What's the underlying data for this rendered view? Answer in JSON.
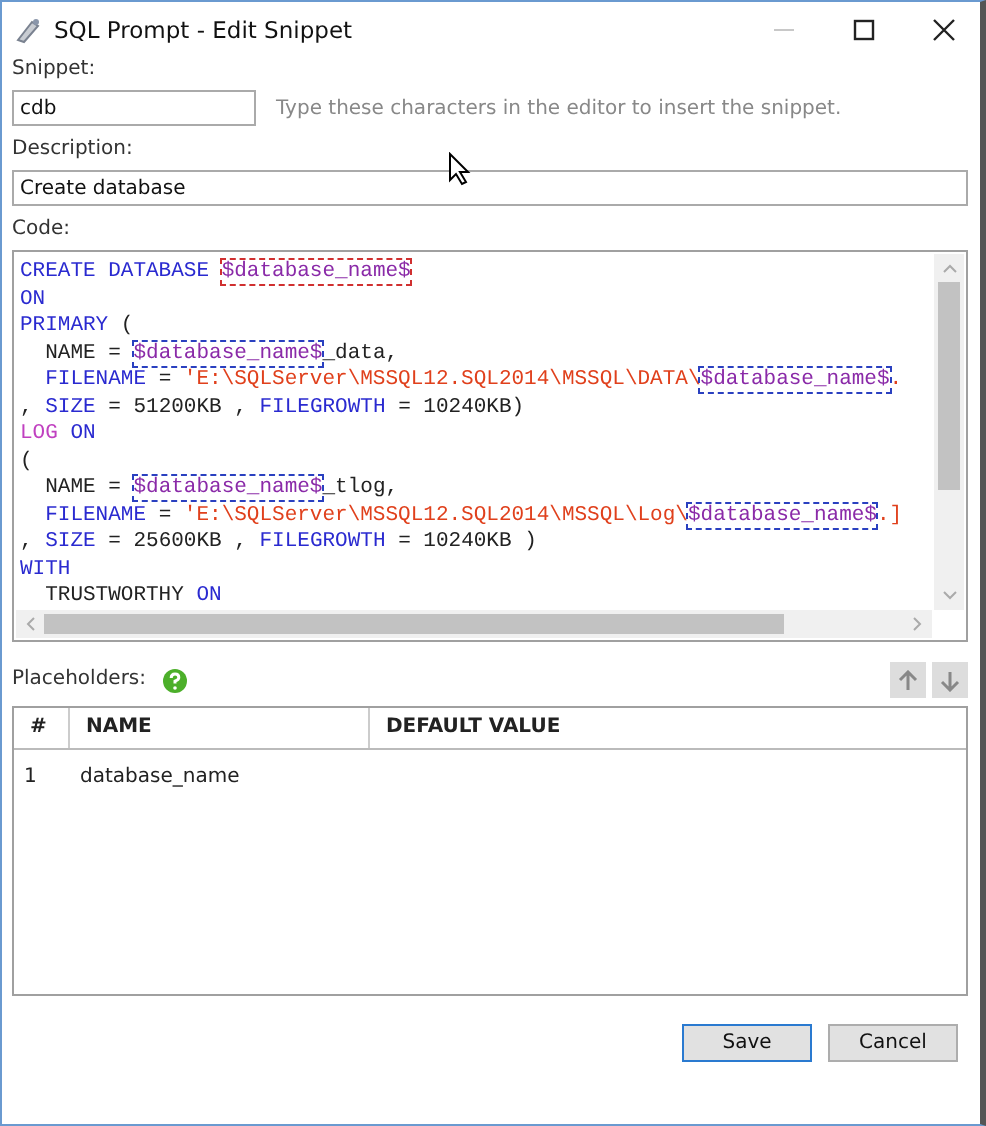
{
  "window": {
    "title": "SQL Prompt - Edit Snippet"
  },
  "snippet": {
    "label": "Snippet:",
    "value": "cdb",
    "hint": "Type these characters in the editor to insert the snippet."
  },
  "description": {
    "label": "Description:",
    "value": "Create database"
  },
  "code": {
    "label": "Code:",
    "lines": [
      [
        {
          "kind": "kw",
          "text": "CREATE DATABASE "
        },
        {
          "kind": "ph",
          "text": "$database_name$",
          "active": true
        }
      ],
      [
        {
          "kind": "kw",
          "text": "ON"
        }
      ],
      [
        {
          "kind": "kw",
          "text": "PRIMARY"
        },
        {
          "kind": "text",
          "text": " ("
        }
      ],
      [
        {
          "kind": "text",
          "text": "  NAME = "
        },
        {
          "kind": "ph",
          "text": "$database_name$",
          "active": false
        },
        {
          "kind": "text",
          "text": "_data,"
        }
      ],
      [
        {
          "kind": "kw",
          "text": "  FILENAME"
        },
        {
          "kind": "text",
          "text": " = "
        },
        {
          "kind": "str",
          "text": "'E:\\SQLServer\\MSSQL12.SQL2014\\MSSQL\\DATA\\"
        },
        {
          "kind": "ph",
          "text": "$database_name$",
          "active": false
        },
        {
          "kind": "str",
          "text": "."
        }
      ],
      [
        {
          "kind": "text",
          "text": ", "
        },
        {
          "kind": "kw",
          "text": "SIZE"
        },
        {
          "kind": "text",
          "text": " = 51200KB , "
        },
        {
          "kind": "kw",
          "text": "FILEGROWTH"
        },
        {
          "kind": "text",
          "text": " = 10240KB)"
        }
      ],
      [
        {
          "kind": "fn",
          "text": "LOG"
        },
        {
          "kind": "kw",
          "text": " ON"
        }
      ],
      [
        {
          "kind": "text",
          "text": "("
        }
      ],
      [
        {
          "kind": "text",
          "text": "  NAME = "
        },
        {
          "kind": "ph",
          "text": "$database_name$",
          "active": false
        },
        {
          "kind": "text",
          "text": "_tlog,"
        }
      ],
      [
        {
          "kind": "kw",
          "text": "  FILENAME"
        },
        {
          "kind": "text",
          "text": " = "
        },
        {
          "kind": "str",
          "text": "'E:\\SQLServer\\MSSQL12.SQL2014\\MSSQL\\Log\\"
        },
        {
          "kind": "ph",
          "text": "$database_name$",
          "active": false
        },
        {
          "kind": "str",
          "text": ".]"
        }
      ],
      [
        {
          "kind": "text",
          "text": ", "
        },
        {
          "kind": "kw",
          "text": "SIZE"
        },
        {
          "kind": "text",
          "text": " = 25600KB , "
        },
        {
          "kind": "kw",
          "text": "FILEGROWTH"
        },
        {
          "kind": "text",
          "text": " = 10240KB )"
        }
      ],
      [
        {
          "kind": "kw",
          "text": "WITH"
        }
      ],
      [
        {
          "kind": "text",
          "text": "  TRUSTWORTHY "
        },
        {
          "kind": "kw",
          "text": "ON"
        }
      ]
    ]
  },
  "placeholders": {
    "label": "Placeholders:",
    "move_up": {
      "disabled": true
    },
    "move_down": {
      "disabled": true
    },
    "columns": [
      "#",
      "NAME",
      "DEFAULT VALUE"
    ],
    "rows": [
      {
        "index": "1",
        "name": "database_name"
      }
    ]
  },
  "buttons": [
    {
      "label": "Save",
      "default": true
    },
    {
      "label": "Cancel",
      "default": false
    }
  ]
}
